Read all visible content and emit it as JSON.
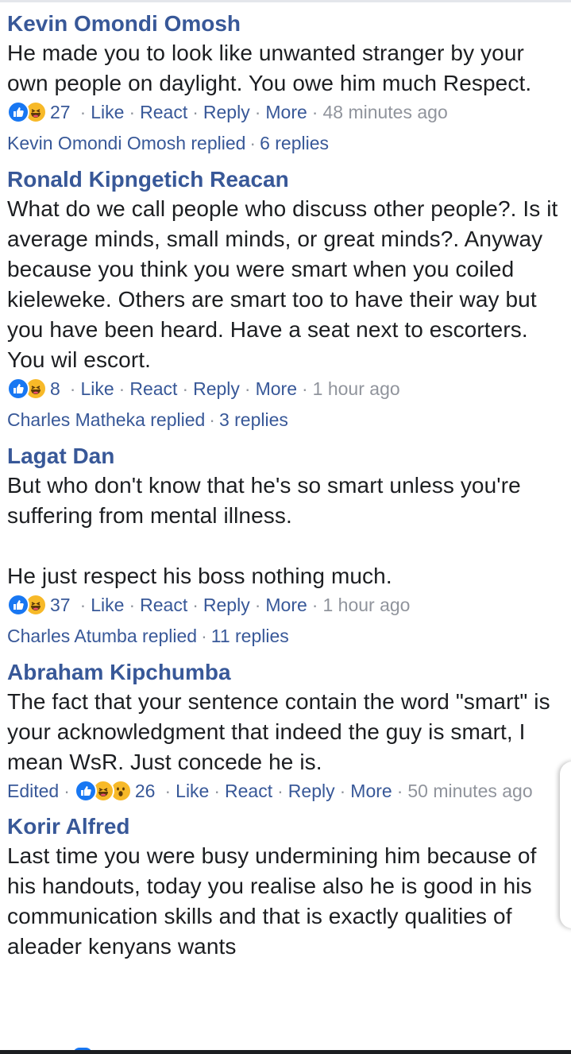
{
  "colors": {
    "author": "#385898",
    "text": "#1c1e21",
    "meta_grey": "#90949c",
    "like_blue": "#1877f2",
    "haha_yellow": "#f7b928"
  },
  "comments": [
    {
      "author": "Kevin Omondi Omosh",
      "text": "He made you to look like unwanted stranger by your own people on daylight. You owe him much Respect.",
      "reaction_icons": [
        "like-icon",
        "haha-icon"
      ],
      "reaction_count": "27",
      "like": "Like",
      "react": "React",
      "reply": "Reply",
      "more": "More",
      "time": "48 minutes ago",
      "replies_by": "Kevin Omondi Omosh replied",
      "replies_count": "6 replies"
    },
    {
      "author": "Ronald Kipngetich Reacan",
      "text": "What do we call people who discuss other people?. Is it average minds, small minds, or great minds?. Anyway because you think you were smart when you coiled kieleweke. Others are smart too to have their way but you have been heard. Have a seat next to escorters. You wil escort.",
      "reaction_icons": [
        "like-icon",
        "haha-icon"
      ],
      "reaction_count": "8",
      "like": "Like",
      "react": "React",
      "reply": "Reply",
      "more": "More",
      "time": "1 hour ago",
      "replies_by": "Charles Matheka replied",
      "replies_count": "3 replies"
    },
    {
      "author": "Lagat Dan",
      "text": "But who don't know that he's so smart unless you're suffering from mental illness.\n\nHe just respect his boss nothing much.",
      "reaction_icons": [
        "like-icon",
        "haha-icon"
      ],
      "reaction_count": "37",
      "like": "Like",
      "react": "React",
      "reply": "Reply",
      "more": "More",
      "time": "1 hour ago",
      "replies_by": "Charles Atumba replied",
      "replies_count": "11 replies"
    },
    {
      "author": "Abraham Kipchumba",
      "text": "The fact that your sentence contain the word \"smart\" is your acknowledgment that indeed the guy is smart, I mean WsR. Just concede he is.",
      "edited": "Edited",
      "reaction_icons": [
        "like-icon",
        "haha-icon",
        "wow-icon"
      ],
      "reaction_count": "26",
      "like": "Like",
      "react": "React",
      "reply": "Reply",
      "more": "More",
      "time": "50 minutes ago"
    },
    {
      "author": "Korir Alfred",
      "text": "Last time you were busy undermining him because of his handouts, today you realise also he is good in his communication skills and that is exactly qualities of aleader kenyans wants"
    }
  ]
}
